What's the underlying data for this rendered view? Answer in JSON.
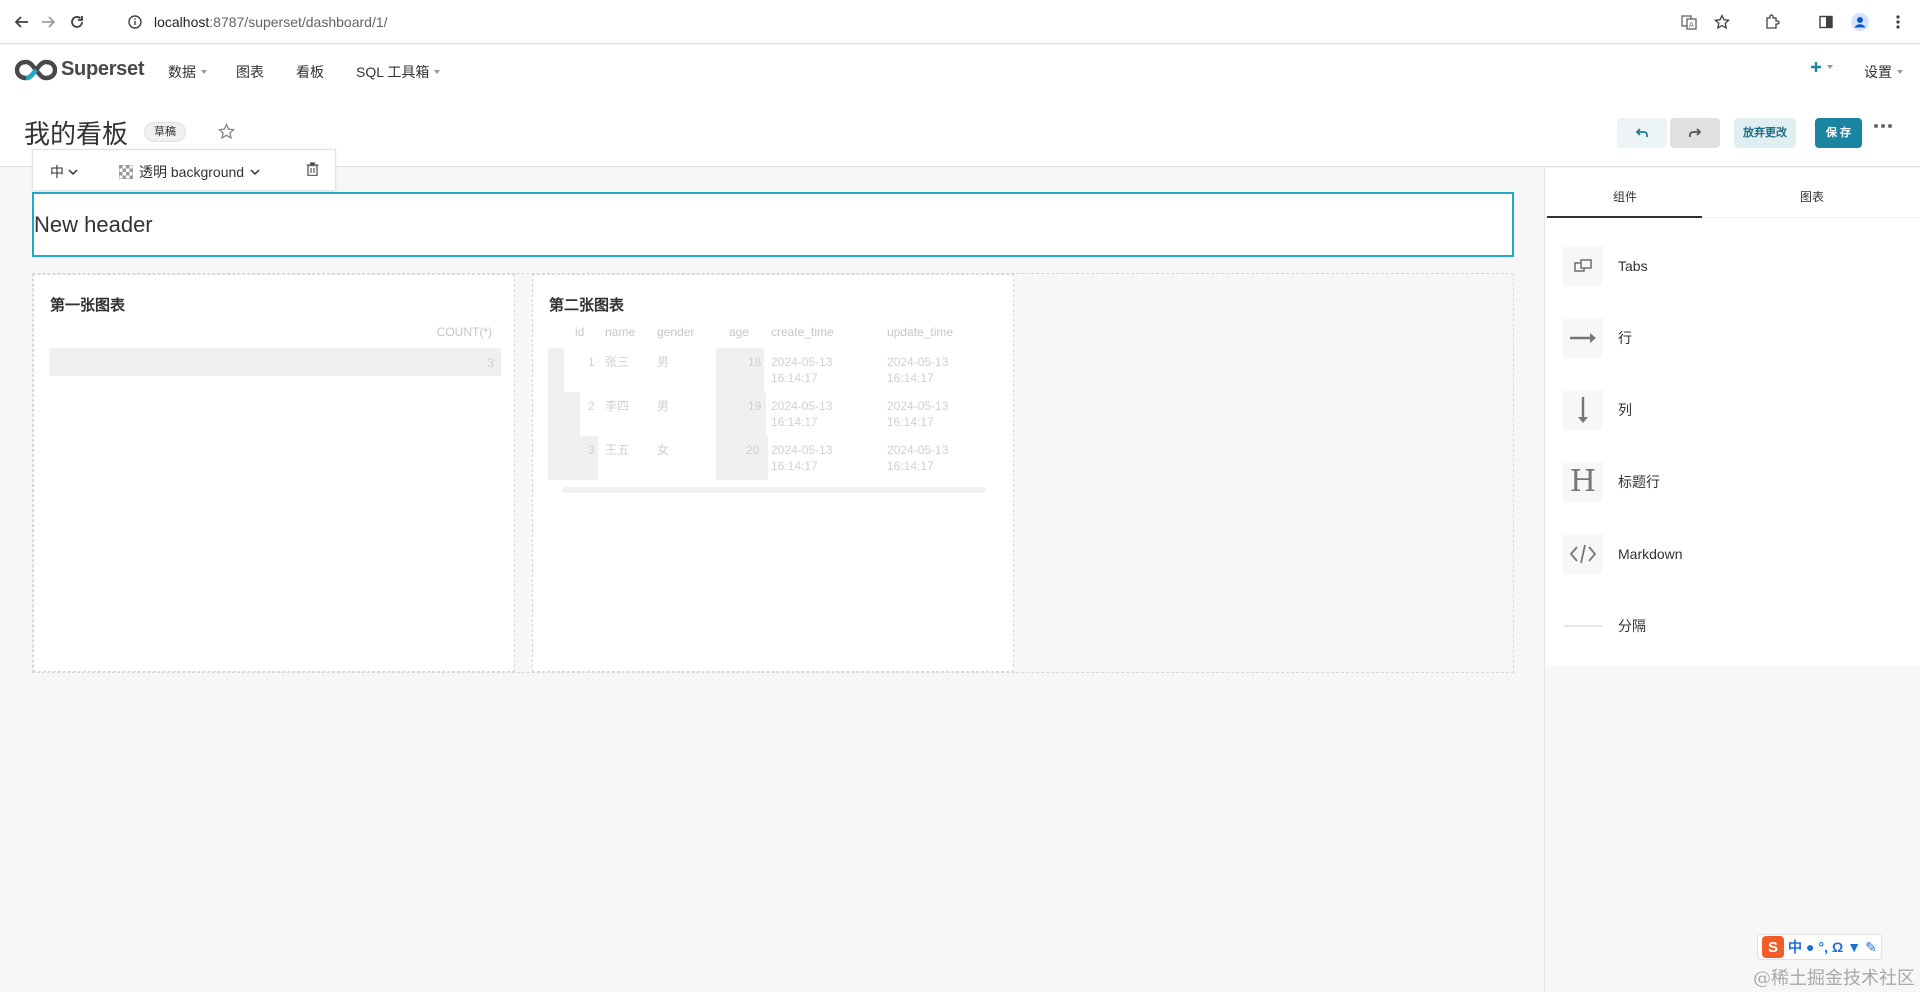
{
  "browser": {
    "url_host": "localhost",
    "url_path": ":8787/superset/dashboard/1/"
  },
  "app": {
    "brand": "Superset",
    "nav": [
      {
        "label": "数据",
        "has_caret": true
      },
      {
        "label": "图表",
        "has_caret": false
      },
      {
        "label": "看板",
        "has_caret": false
      },
      {
        "label": "SQL 工具箱",
        "has_caret": true
      }
    ],
    "settings_label": "设置"
  },
  "dashboard": {
    "title": "我的看板",
    "status_badge": "草稿",
    "discard_label": "放弃更改",
    "save_label": "保 存"
  },
  "header_toolbar": {
    "size_value": "中",
    "background_value": "透明 background"
  },
  "header_block": {
    "text": "New header"
  },
  "charts": [
    {
      "title": "第一张图表",
      "columns": [
        "COUNT(*)"
      ],
      "rows": [
        [
          "3"
        ]
      ]
    },
    {
      "title": "第二张图表",
      "columns": [
        "id",
        "name",
        "gender",
        "age",
        "create_time",
        "update_time"
      ],
      "rows": [
        [
          "1",
          "张三",
          "男",
          "18",
          "2024-05-13 16:14:17",
          "2024-05-13 16:14:17"
        ],
        [
          "2",
          "李四",
          "男",
          "19",
          "2024-05-13 16:14:17",
          "2024-05-13 16:14:17"
        ],
        [
          "3",
          "王五",
          "女",
          "20",
          "2024-05-13 16:14:17",
          "2024-05-13 16:14:17"
        ]
      ]
    }
  ],
  "panel": {
    "tabs": [
      "组件",
      "图表"
    ],
    "active_tab": "组件",
    "components": [
      {
        "label": "Tabs",
        "icon": "tabs-icon"
      },
      {
        "label": "行",
        "icon": "row-arrow-right-icon"
      },
      {
        "label": "列",
        "icon": "column-arrow-down-icon"
      },
      {
        "label": "标题行",
        "icon": "header-h-icon"
      },
      {
        "label": "Markdown",
        "icon": "markdown-code-icon"
      },
      {
        "label": "分隔",
        "icon": "divider-icon"
      }
    ]
  },
  "ime": {
    "lang": "中"
  },
  "watermark": "@稀土掘金技术社区",
  "colors": {
    "primary": "#1985a0",
    "accent_border": "#20a7c9",
    "ime_brand": "#f25c27"
  }
}
